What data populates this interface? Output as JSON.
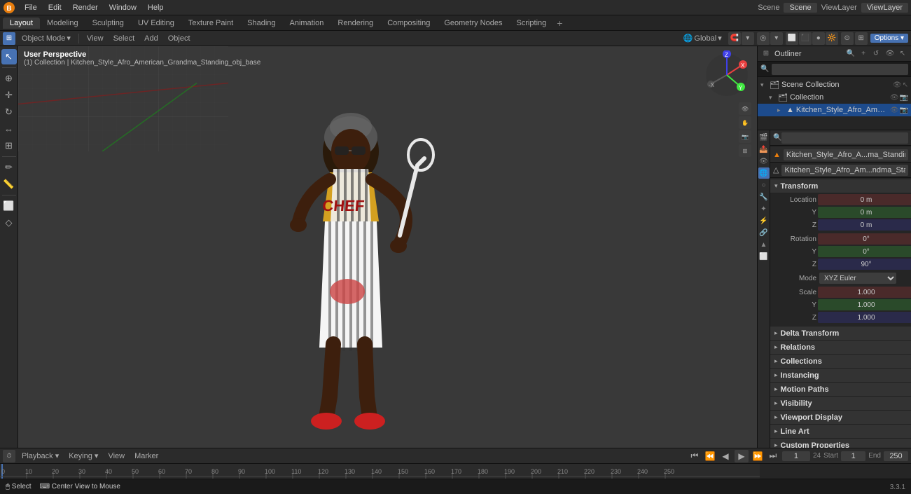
{
  "app": {
    "title": "Blender",
    "version": "3.3.1"
  },
  "topMenu": {
    "items": [
      "Blender",
      "File",
      "Edit",
      "Render",
      "Window",
      "Help"
    ]
  },
  "workspaceTabs": {
    "tabs": [
      "Layout",
      "Modeling",
      "Sculpting",
      "UV Editing",
      "Texture Paint",
      "Shading",
      "Animation",
      "Rendering",
      "Compositing",
      "Geometry Nodes",
      "Scripting"
    ],
    "active": "Layout",
    "addLabel": "+"
  },
  "viewportHeader": {
    "objectMode": "Object Mode",
    "view": "View",
    "select": "Select",
    "add": "Add",
    "object": "Object",
    "transform": "Global",
    "snap": "☉",
    "proportional": "◎"
  },
  "viewport": {
    "info_line1": "User Perspective",
    "info_line2": "(1) Collection | Kitchen_Style_Afro_American_Grandma_Standing_obj_base",
    "options": "Options ▾"
  },
  "outliner": {
    "title": "Outliner",
    "scene_label": "Scene",
    "view_layer": "ViewLayer",
    "search_placeholder": "",
    "items": [
      {
        "label": "Scene Collection",
        "level": 0,
        "expanded": true,
        "icon": "📁"
      },
      {
        "label": "Collection",
        "level": 1,
        "expanded": true,
        "icon": "📁"
      },
      {
        "label": "Kitchen_Style_Afro_American_Gran",
        "level": 2,
        "expanded": false,
        "icon": "▲",
        "selected": true
      }
    ]
  },
  "propertiesPanel": {
    "searchPlaceholder": "",
    "objectName": "Kitchen_Style_Afro_A...ma_Standing_obj_base",
    "meshName": "Kitchen_Style_Afro_Am...ndma_Standing_obj_base",
    "tabs": [
      "scene",
      "render",
      "output",
      "view",
      "object",
      "modifier",
      "particle",
      "physics",
      "constraint",
      "data",
      "material",
      "world",
      "objectdata"
    ],
    "transform": {
      "title": "Transform",
      "location": {
        "label": "Location",
        "x_label": "X",
        "y_label": "Y",
        "z_label": "Z",
        "x_val": "0 m",
        "y_val": "0 m",
        "z_val": "0 m"
      },
      "rotation": {
        "label": "Rotation",
        "x_label": "X",
        "y_label": "Y",
        "z_label": "Z",
        "x_val": "0°",
        "y_val": "0°",
        "z_val": "90°",
        "mode": "XYZ Euler"
      },
      "scale": {
        "label": "Scale",
        "x_label": "X",
        "y_label": "Y",
        "z_label": "Z",
        "x_val": "1.000",
        "y_val": "1.000",
        "z_val": "1.000"
      }
    },
    "sections": [
      {
        "label": "Delta Transform",
        "expanded": false
      },
      {
        "label": "Relations",
        "expanded": false
      },
      {
        "label": "Collections",
        "expanded": false
      },
      {
        "label": "Instancing",
        "expanded": false
      },
      {
        "label": "Motion Paths",
        "expanded": false
      },
      {
        "label": "Visibility",
        "expanded": false
      },
      {
        "label": "Viewport Display",
        "expanded": false
      },
      {
        "label": "Line Art",
        "expanded": false
      },
      {
        "label": "Custom Properties",
        "expanded": false
      }
    ]
  },
  "timeline": {
    "playbackLabel": "Playback ▾",
    "keyingLabel": "Keying ▾",
    "viewLabel": "View",
    "markerLabel": "Marker",
    "currentFrame": "1",
    "startFrame": "1",
    "endFrame": "250",
    "fps": "24",
    "timeLabel": "Start",
    "endTimeLabel": "End"
  },
  "statusBar": {
    "selectLabel": "Select",
    "centerViewLabel": "Center View to Mouse",
    "version": "3.3.1"
  },
  "timelineRuler": {
    "markers": [
      "0",
      "10",
      "20",
      "30",
      "40",
      "50",
      "60",
      "70",
      "80",
      "90",
      "100",
      "110",
      "120",
      "130",
      "140",
      "150",
      "160",
      "170",
      "180",
      "190",
      "200",
      "210",
      "220",
      "230",
      "240",
      "250"
    ]
  }
}
